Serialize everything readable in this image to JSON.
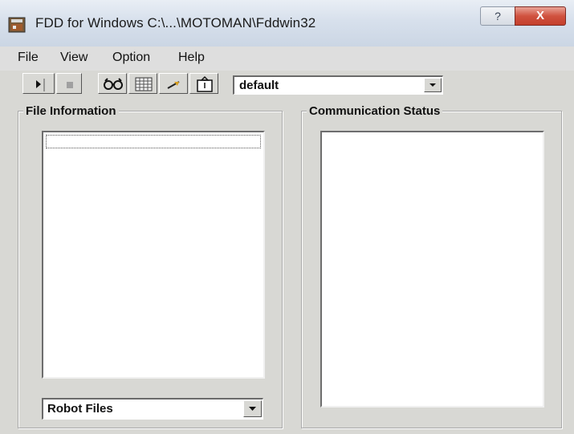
{
  "window": {
    "title": "FDD for Windows  C:\\...\\MOTOMAN\\Fddwin32",
    "help_glyph": "?",
    "close_glyph": "X"
  },
  "menu": {
    "items": [
      "File",
      "View",
      "Option",
      "Help"
    ]
  },
  "toolbar": {
    "buttons": [
      "play-icon",
      "stop-icon",
      "glasses-icon",
      "grid-icon",
      "arrow-icon",
      "folder-icon"
    ],
    "profile_value": "default"
  },
  "file_info": {
    "title": "File Information",
    "type_value": "Robot Files"
  },
  "comm_status": {
    "title": "Communication Status"
  },
  "colors": {
    "window_bg": "#d8d8d4",
    "titlebar": "#d7e0ec",
    "close": "#c43f2c"
  }
}
